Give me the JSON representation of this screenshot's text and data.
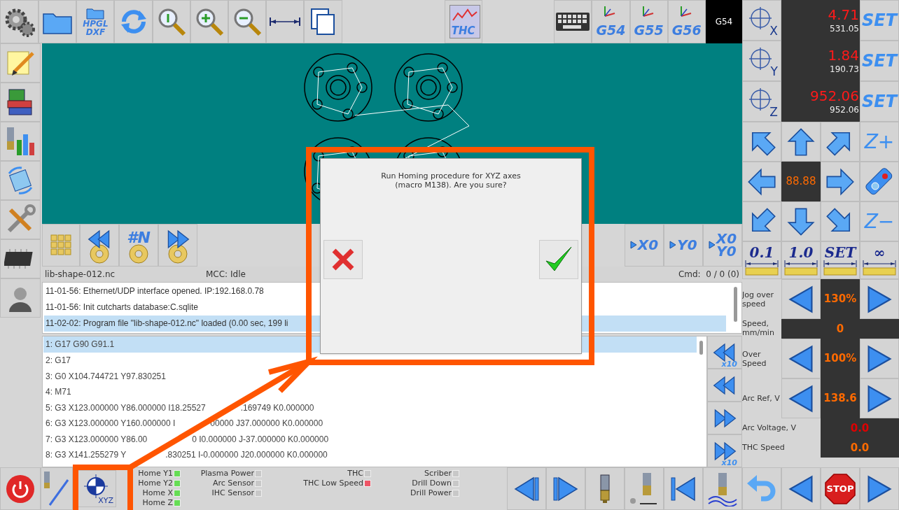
{
  "toolbar": {
    "hpgl_label": "HPGL",
    "dxf_label": "DXF",
    "thc_label": "THC",
    "offset_buttons": [
      {
        "label": "G54"
      },
      {
        "label": "G55"
      },
      {
        "label": "G56"
      }
    ],
    "current_offset": "G54"
  },
  "canvas_tools": {
    "frame_label": "#N",
    "zero_buttons": [
      "X0",
      "Y0",
      "X0 Y0"
    ]
  },
  "status": {
    "file": "lib-shape-012.nc",
    "mcc": "MCC:  Idle",
    "cmd": "Cmd:  0 / 0 (0)"
  },
  "log": [
    {
      "text": "11-01-56: Ethernet/UDP interface opened. IP:192.168.0.78",
      "selected": false
    },
    {
      "text": "11-01-56: Init cutcharts database:C.sqlite",
      "selected": false
    },
    {
      "text": "11-02-02: Program file \"lib-shape-012.nc\" loaded (0.00 sec, 199 li",
      "selected": true
    }
  ],
  "program": [
    {
      "segments": [
        "1: G17 G90 G91.1"
      ],
      "selected": true
    },
    {
      "segments": [
        "2: G17"
      ],
      "selected": false
    },
    {
      "segments": [
        "3: G0 X104.744721 Y97.830251"
      ],
      "selected": false
    },
    {
      "segments": [
        "4: M71"
      ],
      "selected": false
    },
    {
      "segments": [
        "5: G3 X123.000000 Y86.000000 I18.25527",
        ".169749 K0.000000"
      ],
      "selected": false
    },
    {
      "segments": [
        "6: G3 X123.000000 Y160.000000 I",
        "00000 J37.000000 K0.000000"
      ],
      "selected": false
    },
    {
      "segments": [
        "7: G3 X123.000000 Y86.00",
        "0 I0.000000 J-37.000000 K0.000000"
      ],
      "selected": false
    },
    {
      "segments": [
        "8: G3 X141.255279 Y",
        ".830251 I-0.000000 J20.000000 K0.000000"
      ],
      "selected": false
    }
  ],
  "program_nav": [
    {
      "kind": "back",
      "label": "x10"
    },
    {
      "kind": "back"
    },
    {
      "kind": "forward"
    },
    {
      "kind": "forward",
      "label": "x10"
    }
  ],
  "dro": [
    {
      "axis": "X",
      "work": "4.71",
      "machine": "531.05",
      "set": "SET"
    },
    {
      "axis": "Y",
      "work": "1.84",
      "machine": "190.73",
      "set": "SET"
    },
    {
      "axis": "Z",
      "work": "952.06",
      "machine": "952.06",
      "set": "SET"
    }
  ],
  "jog": {
    "step_display": "88.88",
    "z_up": "Z+",
    "z_down": "Z−"
  },
  "steps": [
    "0.1",
    "1.0",
    "SET",
    "∞"
  ],
  "controls": [
    {
      "label": "Jog over speed",
      "kind": "adjust",
      "value": "130%",
      "color": "#ff6a00"
    },
    {
      "label": "Speed, mm/min",
      "kind": "readout",
      "value": "0",
      "color": "#ff6a00"
    },
    {
      "label": "Over Speed",
      "kind": "adjust",
      "value": "100%",
      "color": "#ff6a00"
    },
    {
      "label": "Arc Ref, V",
      "kind": "adjust",
      "value": "138.6",
      "color": "#ff6a00"
    },
    {
      "label": "Arc Voltage, V",
      "kind": "meter",
      "value": "0.0",
      "color": "#e00000"
    },
    {
      "label": "THC Speed",
      "kind": "meter",
      "value": "0.0",
      "color": "#ff6a00"
    }
  ],
  "home_button": "XYZ",
  "indicators": [
    [
      {
        "label": "Home Y1",
        "color": "#66dd55"
      },
      {
        "label": "Home Y2",
        "color": "#66dd55"
      },
      {
        "label": "Home X",
        "color": "#66dd55"
      },
      {
        "label": "Home Z",
        "color": "#66dd55"
      }
    ],
    [
      {
        "label": "Plasma Power",
        "color": "#c8c8c8"
      },
      {
        "label": "Arc Sensor",
        "color": "#c8c8c8"
      },
      {
        "label": "IHC Sensor",
        "color": "#c8c8c8"
      }
    ],
    [
      {
        "label": "THC",
        "color": "#c8c8c8"
      },
      {
        "label": "THC Low Speed",
        "color": "#ee5566"
      }
    ],
    [
      {
        "label": "Scriber",
        "color": "#c8c8c8"
      },
      {
        "label": "Drill Down",
        "color": "#c8c8c8"
      },
      {
        "label": "Drill Power",
        "color": "#c8c8c8"
      }
    ]
  ],
  "stop_label": "STOP",
  "dialog": {
    "message": "Run Homing procedure for XYZ axes\n(macro M138). Are you sure?"
  }
}
